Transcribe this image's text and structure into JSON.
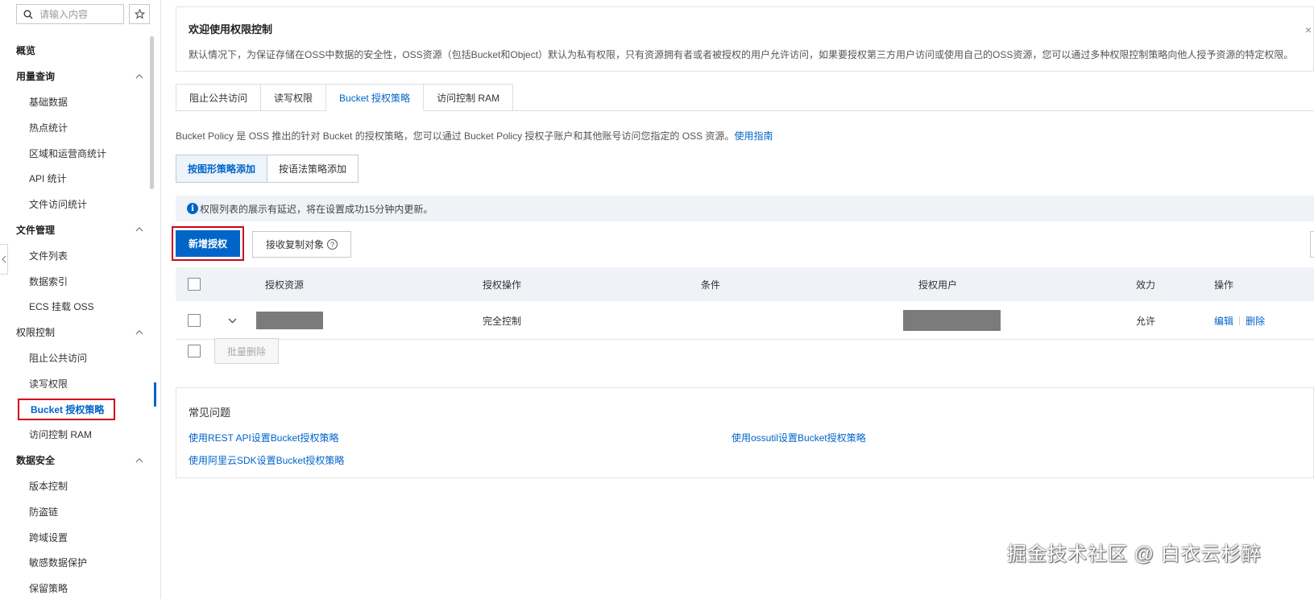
{
  "search": {
    "placeholder": "请输入内容"
  },
  "sidebar": {
    "items": [
      {
        "type": "group",
        "label": "概览",
        "collapsible": false
      },
      {
        "type": "group",
        "label": "用量查询",
        "collapsible": true
      },
      {
        "type": "item",
        "label": "基础数据"
      },
      {
        "type": "item",
        "label": "热点统计"
      },
      {
        "type": "item",
        "label": "区域和运营商统计"
      },
      {
        "type": "item",
        "label": "API 统计"
      },
      {
        "type": "item",
        "label": "文件访问统计"
      },
      {
        "type": "group",
        "label": "文件管理",
        "collapsible": true
      },
      {
        "type": "item",
        "label": "文件列表"
      },
      {
        "type": "item",
        "label": "数据索引"
      },
      {
        "type": "item",
        "label": "ECS 挂载 OSS"
      },
      {
        "type": "group",
        "label": "权限控制",
        "collapsible": true,
        "bold": false
      },
      {
        "type": "item",
        "label": "阻止公共访问"
      },
      {
        "type": "item",
        "label": "读写权限"
      },
      {
        "type": "item",
        "label": "Bucket 授权策略",
        "active": true
      },
      {
        "type": "item",
        "label": "访问控制 RAM"
      },
      {
        "type": "group",
        "label": "数据安全",
        "collapsible": true
      },
      {
        "type": "item",
        "label": "版本控制"
      },
      {
        "type": "item",
        "label": "防盗链"
      },
      {
        "type": "item",
        "label": "跨域设置"
      },
      {
        "type": "item",
        "label": "敏感数据保护"
      },
      {
        "type": "item",
        "label": "保留策略"
      }
    ]
  },
  "welcome": {
    "title": "欢迎使用权限控制",
    "text": "默认情况下，为保证存储在OSS中数据的安全性，OSS资源（包括Bucket和Object）默认为私有权限，只有资源拥有者或者被授权的用户允许访问，如果要授权第三方用户访问或使用自己的OSS资源，您可以通过多种权限控制策略向他人授予资源的特定权限。",
    "close": "×"
  },
  "tabs": [
    {
      "label": "阻止公共访问"
    },
    {
      "label": "读写权限"
    },
    {
      "label": "Bucket 授权策略",
      "active": true
    },
    {
      "label": "访问控制 RAM"
    }
  ],
  "description": {
    "text": "Bucket Policy 是 OSS 推出的针对 Bucket 的授权策略，您可以通过 Bucket Policy 授权子账户和其他账号访问您指定的 OSS 资源。",
    "link": "使用指南"
  },
  "mode_buttons": {
    "graphic": "按图形策略添加",
    "syntax": "按语法策略添加"
  },
  "notice": {
    "icon": "info-icon",
    "text": "权限列表的展示有延迟，将在设置成功15分钟内更新。"
  },
  "actions": {
    "add": "新增授权",
    "receive": "接收复制对象",
    "help_icon": "?"
  },
  "table": {
    "headers": [
      "授权资源",
      "授权操作",
      "条件",
      "授权用户",
      "效力",
      "操作"
    ],
    "rows": [
      {
        "resource": "",
        "operation": "完全控制",
        "condition": "",
        "user": "",
        "effect": "允许",
        "edit": "编辑",
        "delete": "删除"
      }
    ],
    "batch_delete": "批量删除"
  },
  "faq": {
    "title": "常见问题",
    "links": [
      "使用REST API设置Bucket授权策略",
      "使用ossutil设置Bucket授权策略",
      "使用阿里云SDK设置Bucket授权策略"
    ]
  },
  "watermark": "掘金技术社区 @ 白衣云杉醉",
  "colors": {
    "primary": "#0064c8",
    "highlight_border": "#d0021b",
    "masked": "#7b7b7b"
  }
}
